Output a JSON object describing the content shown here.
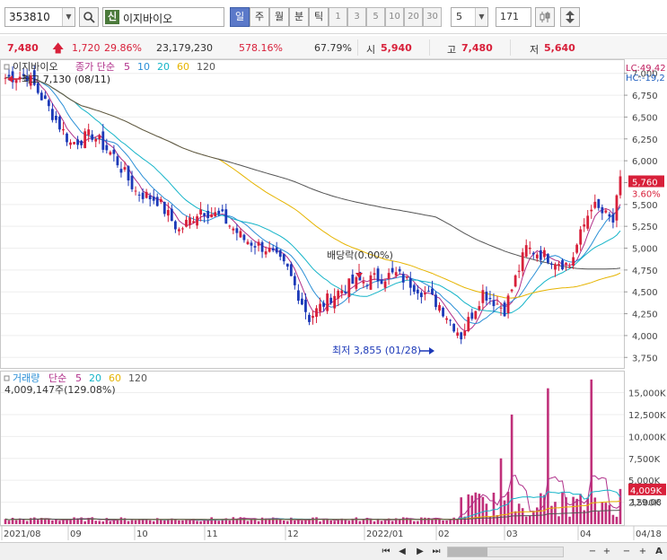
{
  "toolbar": {
    "code": "353810",
    "name": "이지바이오",
    "name_badge": "신",
    "period_buttons": [
      "일",
      "주",
      "월",
      "분",
      "틱"
    ],
    "selected_period": "일",
    "minute_buttons": [
      "1",
      "3",
      "5",
      "10",
      "20",
      "30"
    ],
    "interval_value": "5",
    "count_value": "171"
  },
  "info": {
    "price": "7,480",
    "change": "1,720",
    "change_pct": "29.86%",
    "volume": "23,179,230",
    "volume_ratio": "578.16%",
    "turnover": "67.79%",
    "open_label": "시",
    "open": "5,940",
    "high_label": "고",
    "high": "7,480",
    "low_label": "저",
    "low": "5,640"
  },
  "price_panel": {
    "title": "이지바이오",
    "ma_label": "종가 단순",
    "ma_periods": [
      "5",
      "10",
      "20",
      "60",
      "120"
    ],
    "lc_label": "LC:49,42",
    "hc_label": "HC:-19,2",
    "high_annot": "최고 7,130 (08/11)",
    "low_annot": "최저 3,855 (01/28)",
    "dividend_annot": "배당락(0.00%)",
    "current_price_tag": "5,760",
    "current_pct_tag": "3.60%",
    "y_ticks": [
      "7,000",
      "6,750",
      "6,500",
      "6,250",
      "6,000",
      "5,750",
      "5,500",
      "5,250",
      "5,000",
      "4,750",
      "4,500",
      "4,250",
      "4,000",
      "3,750"
    ]
  },
  "volume_panel": {
    "title": "거래량",
    "ma_label": "단순",
    "ma_periods": [
      "5",
      "20",
      "60",
      "120"
    ],
    "volume_text": "4,009,147주(129.08%)",
    "current_tag": "4,009K",
    "current_pct_tag": "129.08",
    "y_ticks": [
      "15,000K",
      "12,500K",
      "10,000K",
      "7,500K",
      "5,000K",
      "2,500K"
    ]
  },
  "x_axis": [
    "2021/08",
    "09",
    "10",
    "11",
    "12",
    "2022/01",
    "02",
    "03",
    "04",
    "04/18"
  ],
  "colors": {
    "up": "#d8203a",
    "down": "#1c39b8",
    "ma5": "#b0308a",
    "ma10": "#2b8fd6",
    "ma20": "#14b4c8",
    "ma60": "#e6b400",
    "ma120": "#555555",
    "volume_bar": "#c0307a"
  }
}
